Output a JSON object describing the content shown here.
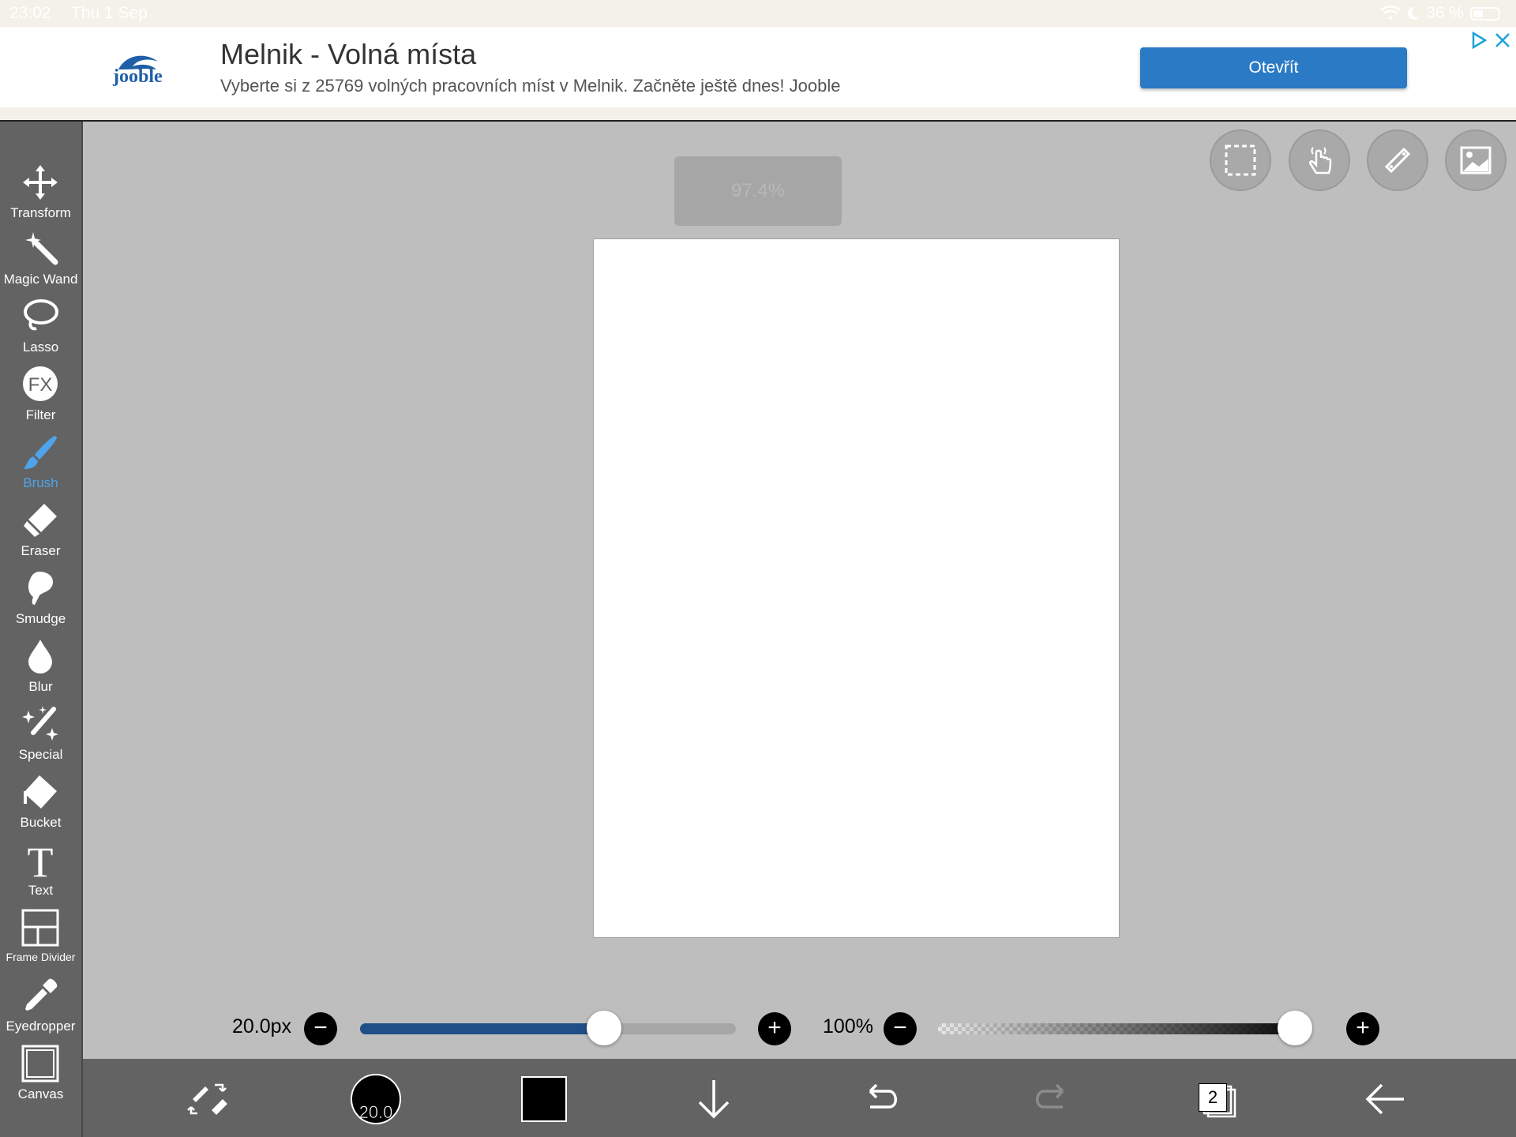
{
  "status_bar": {
    "time": "23:02",
    "date": "Thu 1 Sep",
    "battery": "36 %"
  },
  "ad": {
    "logo": "jooble",
    "title": "Melnik - Volná místa",
    "description": "Vyberte si z 25769 volných pracovních míst v Melnik. Začněte ještě dnes! Jooble",
    "cta_label": "Otevřít"
  },
  "tools": [
    {
      "label": "Transform",
      "icon": "move-arrows-icon"
    },
    {
      "label": "Magic Wand",
      "icon": "magic-wand-icon"
    },
    {
      "label": "Lasso",
      "icon": "lasso-icon"
    },
    {
      "label": "Filter",
      "icon": "fx-icon"
    },
    {
      "label": "Brush",
      "icon": "brush-icon",
      "active": true
    },
    {
      "label": "Eraser",
      "icon": "eraser-icon"
    },
    {
      "label": "Smudge",
      "icon": "smudge-icon"
    },
    {
      "label": "Blur",
      "icon": "drop-icon"
    },
    {
      "label": "Special",
      "icon": "sparkle-pen-icon"
    },
    {
      "label": "Bucket",
      "icon": "bucket-icon"
    },
    {
      "label": "Text",
      "icon": "text-icon"
    },
    {
      "label": "Frame Divider",
      "icon": "frame-divider-icon"
    },
    {
      "label": "Eyedropper",
      "icon": "eyedropper-icon"
    },
    {
      "label": "Canvas",
      "icon": "canvas-icon"
    }
  ],
  "zoom_badge": "97.4%",
  "brush_size": {
    "label": "20.0px",
    "value_fraction": 0.65
  },
  "opacity": {
    "label": "100%",
    "value_fraction": 1.0
  },
  "bottom_bar": {
    "brush_size_indicator": "20.0",
    "layer_count": "2",
    "primary_color": "#000000"
  },
  "colors": {
    "accent": "#4ea4ec",
    "toolbar": "#636363",
    "canvas_bg": "#bebebe",
    "cta": "#2a7ac6"
  }
}
